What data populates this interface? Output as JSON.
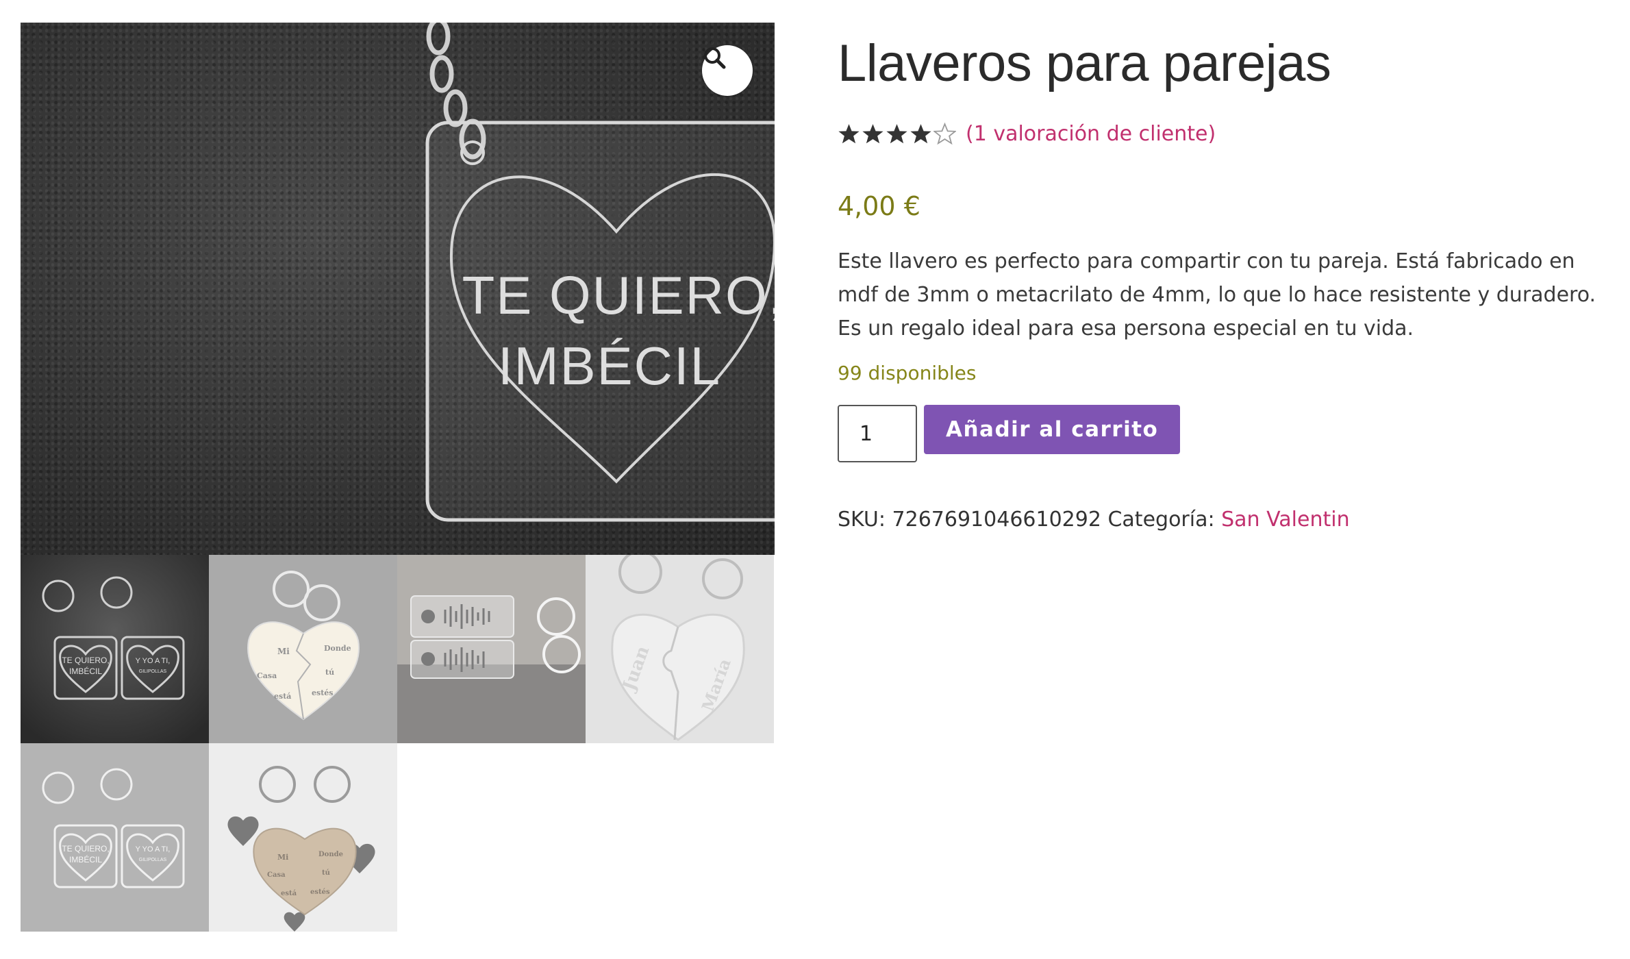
{
  "product": {
    "title": "Llaveros para parejas",
    "rating": 4,
    "rating_max": 5,
    "review_link": "(1 valoración de cliente)",
    "price": "4,00 €",
    "description": "Este llavero es perfecto para compartir con tu pareja. Está fabricado en mdf de 3mm o metacrilato de 4mm, lo que lo hace resistente y duradero. Es un regalo ideal para esa persona especial en tu vida.",
    "stock": "99 disponibles",
    "quantity": "1",
    "add_to_cart": "Añadir al carrito",
    "sku_label": "SKU:",
    "sku": "7267691046610292",
    "category_label": "Categoría:",
    "category": "San Valentin"
  },
  "main_image": {
    "line1": "TE QUIERO,",
    "line2": "IMBÉCIL",
    "zoom_icon": "magnifier-icon"
  },
  "thumbnails": [
    {
      "left_1": "TE QUIERO,",
      "left_2": "IMBÉCIL",
      "right_1": "Y YO A TI,",
      "right_2": "GILIPOLLAS"
    },
    {
      "w1": "Mi",
      "w2": "Casa",
      "w3": "está",
      "w4": "Donde",
      "w5": "tú",
      "w6": "estés"
    },
    {},
    {
      "name1": "Juan",
      "name2": "María"
    },
    {
      "left_1": "TE QUIERO,",
      "left_2": "IMBÉCIL",
      "right_1": "Y YO A TI,",
      "right_2": "GILIPOLLAS"
    },
    {
      "w1": "Mi",
      "w2": "Casa",
      "w3": "está",
      "w4": "Donde",
      "w5": "tú",
      "w6": "estés"
    }
  ],
  "colors": {
    "link": "#c1306e",
    "price": "#7b7b17",
    "button": "#7f54b3",
    "stars": "#333333"
  }
}
